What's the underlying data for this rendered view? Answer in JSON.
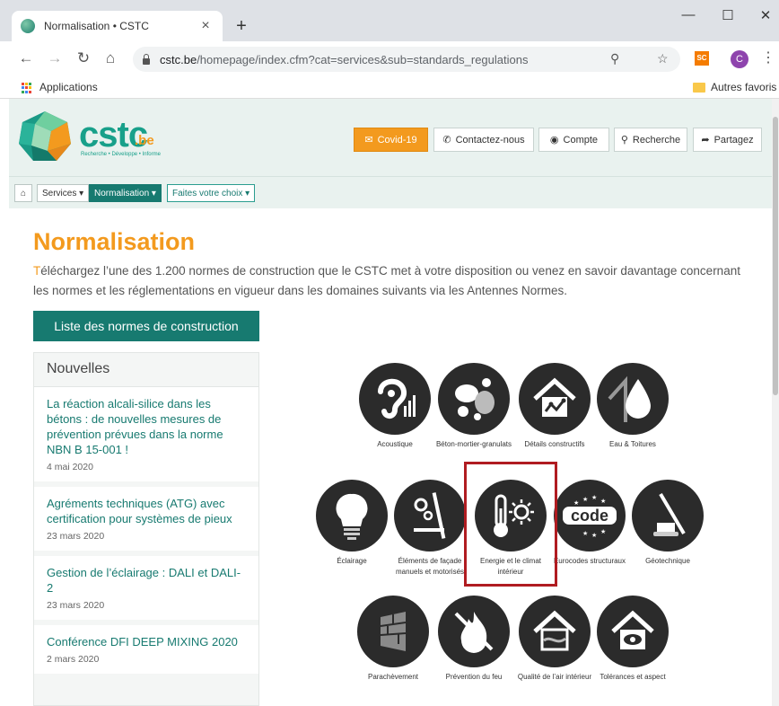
{
  "browser": {
    "tab_title": "Normalisation • CSTC",
    "tab_close": "×",
    "new_tab": "+",
    "win_min": "—",
    "win_max": "☐",
    "win_close": "✕",
    "url_host": "cstc.be",
    "url_path": "/homepage/index.cfm?cat=services&sub=standards_regulations",
    "ext_label": "SC",
    "profile_initial": "C",
    "bookmarks_apps": "Applications",
    "bookmarks_other": "Autres favoris"
  },
  "header": {
    "logo_text": "cstc",
    "logo_suffix": ".be",
    "logo_tagline": "Recherche • Développe • Informe",
    "buttons": {
      "covid": "Covid-19",
      "contact": "Contactez-nous",
      "account": "Compte",
      "search": "Recherche",
      "share": "Partagez"
    }
  },
  "nav": {
    "services": "Services ▾",
    "normalisation": "Normalisation ▾",
    "choice": "Faites votre choix ▾"
  },
  "main": {
    "title": "Normalisation",
    "intro_first_letter": "T",
    "intro": "éléchargez l’une des 1.200 normes de construction que le CSTC met à votre disposition ou venez en savoir davantage concernant les normes et les réglementations en vigueur dans les domaines suivants via les Antennes Normes.",
    "list_button": "Liste des normes de construction"
  },
  "news": {
    "title": "Nouvelles",
    "items": [
      {
        "title": "La réaction alcali-silice dans les bétons : de nouvelles mesures de prévention prévues dans la norme NBN B 15-001 !",
        "date": "4 mai 2020"
      },
      {
        "title": "Agréments techniques (ATG) avec certification pour systèmes de pieux",
        "date": "23 mars 2020"
      },
      {
        "title": "Gestion de l’éclairage : DALI et DALI-2",
        "date": "23 mars 2020"
      },
      {
        "title": "Conférence DFI DEEP MIXING 2020",
        "date": "2 mars 2020"
      }
    ]
  },
  "categories": [
    {
      "label": "Acoustique",
      "icon": "ear-icon"
    },
    {
      "label": "Béton-mortier-granulats",
      "icon": "concrete-mixer-icon"
    },
    {
      "label": "Détails constructifs",
      "icon": "house-detail-icon"
    },
    {
      "label": "Eau & Toitures",
      "icon": "water-drop-roof-icon"
    },
    {
      "label": "Éclairage",
      "icon": "light-bulb-icon"
    },
    {
      "label": "Éléments de façade manuels et motorisés",
      "icon": "facade-gear-icon"
    },
    {
      "label": "Energie et le climat intérieur",
      "icon": "thermometer-sun-icon"
    },
    {
      "label": "Eurocodes structuraux",
      "icon": "eurocode-icon"
    },
    {
      "label": "Géotechnique",
      "icon": "drilling-rig-icon"
    },
    {
      "label": "Parachèvement",
      "icon": "brick-wall-icon"
    },
    {
      "label": "Prévention du feu",
      "icon": "fire-icon"
    },
    {
      "label": "Qualité de l’air intérieur",
      "icon": "house-air-icon"
    },
    {
      "label": "Tolérances et aspect",
      "icon": "house-eye-icon"
    }
  ],
  "colors": {
    "brand_teal": "#177a70",
    "brand_orange": "#f39a1e",
    "highlight_red": "#b01c21"
  }
}
